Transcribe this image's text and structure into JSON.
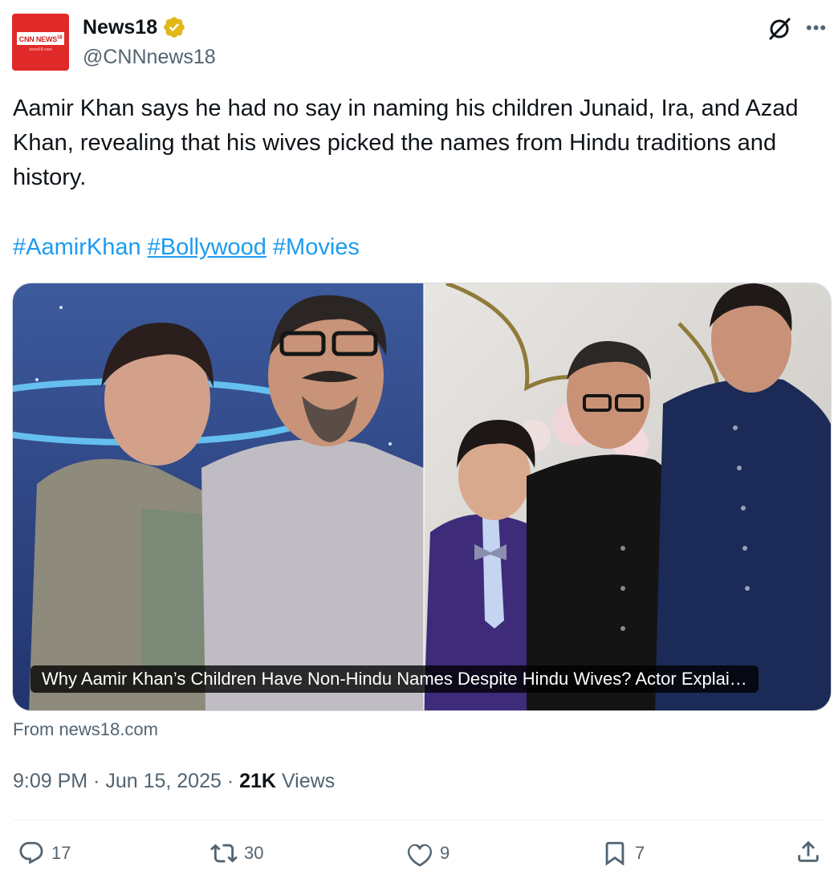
{
  "account": {
    "name": "News18",
    "handle": "@CNNnews18",
    "avatar_logo": "CNN NEWS",
    "avatar_sup": "18",
    "avatar_sub": "news18.com"
  },
  "post": {
    "text": "Aamir Khan says he had no say in naming his children Junaid, Ira, and Azad Khan, revealing that his wives picked the names from Hindu traditions and history.",
    "hashtags": [
      "#AamirKhan",
      "#Bollywood",
      "#Movies"
    ]
  },
  "card": {
    "caption": "Why Aamir Khan’s Children Have Non-Hindu Names Despite Hindu Wives? Actor Explai…",
    "source": "From news18.com"
  },
  "meta": {
    "time": "9:09 PM",
    "date": "Jun 15, 2025",
    "views_count": "21K",
    "views_label": "Views"
  },
  "actions": {
    "replies": "17",
    "reposts": "30",
    "likes": "9",
    "bookmarks": "7"
  },
  "icons": {
    "verified": "verified-badge-icon",
    "grok": "grok-icon",
    "more": "more-icon",
    "reply": "reply-icon",
    "repost": "repost-icon",
    "like": "heart-icon",
    "bookmark": "bookmark-icon",
    "share": "share-icon"
  },
  "colors": {
    "link": "#1d9bf0",
    "secondary_text": "#536471",
    "verified_gold": "#e2b719",
    "brand_red": "#e02a2a"
  }
}
